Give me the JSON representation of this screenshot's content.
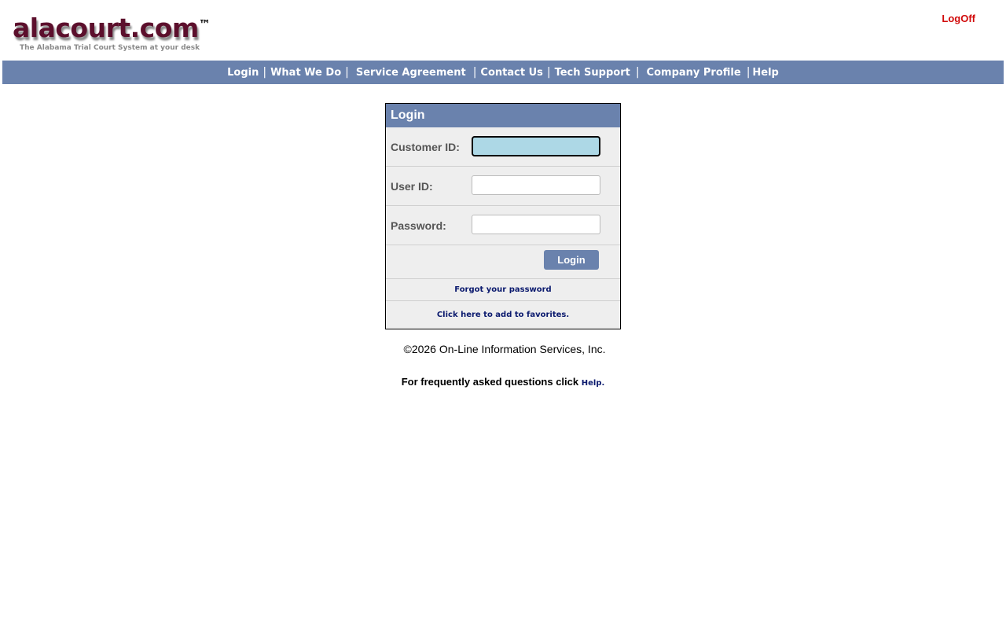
{
  "logo": {
    "title": "alacourt.com",
    "trademark": "™",
    "tagline": "The Alabama Trial Court System at your desk"
  },
  "header": {
    "logoff_label": "LogOff"
  },
  "nav": {
    "items": [
      {
        "label": "Login"
      },
      {
        "label": "What We Do"
      },
      {
        "label": "Service Agreement"
      },
      {
        "label": "Contact Us"
      },
      {
        "label": "Tech Support"
      },
      {
        "label": "Company Profile"
      },
      {
        "label": "Help"
      }
    ],
    "separator": "|"
  },
  "login": {
    "title": "Login",
    "customer_id_label": "Customer ID:",
    "customer_id_value": "",
    "user_id_label": "User ID:",
    "user_id_value": "",
    "password_label": "Password:",
    "password_value": "",
    "button_label": "Login",
    "forgot_label": "Forgot your password",
    "favorites_label": "Click here to add to favorites."
  },
  "footer": {
    "copyright": "©2026 On-Line Information Services, Inc.",
    "faq_text": "For frequently asked questions click",
    "faq_link": "Help."
  },
  "colors": {
    "nav_background": "#6a82ad",
    "logoff": "#d10a0a",
    "focused_input": "#add8e6",
    "link": "#0b1a6e"
  }
}
